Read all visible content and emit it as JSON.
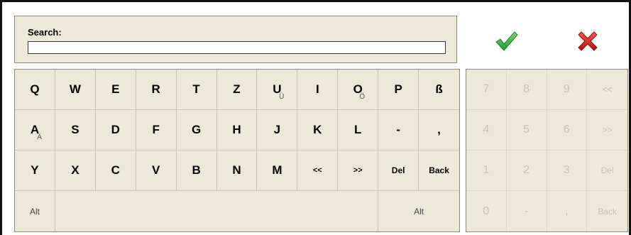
{
  "search": {
    "label": "Search:",
    "value": ""
  },
  "actions": {
    "ok_icon": "checkmark-icon",
    "cancel_icon": "close-icon",
    "ok_color": "#3db83d",
    "cancel_color": "#d22a1e"
  },
  "keyboard": {
    "rows": [
      [
        {
          "label": "Q"
        },
        {
          "label": "W"
        },
        {
          "label": "E"
        },
        {
          "label": "R"
        },
        {
          "label": "T"
        },
        {
          "label": "Z"
        },
        {
          "label": "U",
          "alt": "Ü"
        },
        {
          "label": "I"
        },
        {
          "label": "O",
          "alt": "Ö"
        },
        {
          "label": "P"
        },
        {
          "label": "ß"
        }
      ],
      [
        {
          "label": "A",
          "alt": "Ä"
        },
        {
          "label": "S"
        },
        {
          "label": "D"
        },
        {
          "label": "F"
        },
        {
          "label": "G"
        },
        {
          "label": "H"
        },
        {
          "label": "J"
        },
        {
          "label": "K"
        },
        {
          "label": "L"
        },
        {
          "label": "-"
        },
        {
          "label": ","
        }
      ],
      [
        {
          "label": "Y"
        },
        {
          "label": "X"
        },
        {
          "label": "C"
        },
        {
          "label": "V"
        },
        {
          "label": "B"
        },
        {
          "label": "N"
        },
        {
          "label": "M"
        },
        {
          "label": "<<"
        },
        {
          "label": ">>"
        },
        {
          "label": "Del"
        },
        {
          "label": "Back"
        }
      ]
    ],
    "alt_left": "Alt",
    "alt_right": "Alt",
    "space": ""
  },
  "numpad": {
    "rows": [
      [
        "7",
        "8",
        "9",
        "<<"
      ],
      [
        "4",
        "5",
        "6",
        ">>"
      ],
      [
        "1",
        "2",
        "3",
        "Del"
      ],
      [
        "0",
        "-",
        ",",
        "Back"
      ]
    ]
  }
}
